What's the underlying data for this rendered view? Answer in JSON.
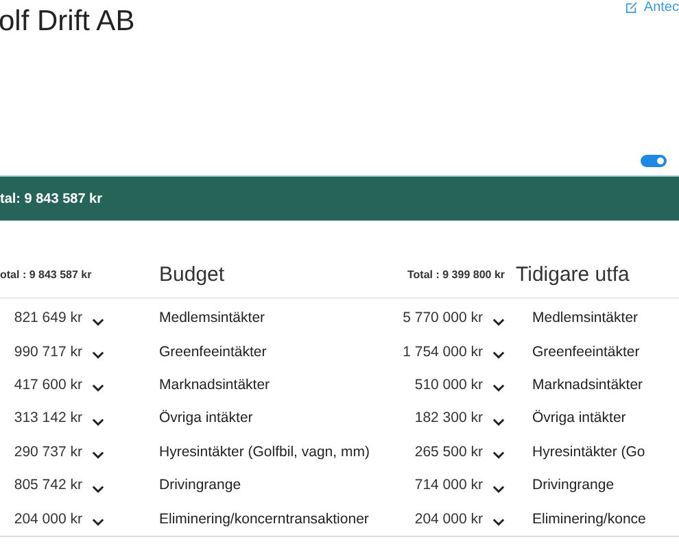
{
  "title": "olf Drift AB",
  "notes_link": "Antec",
  "toggle": {
    "on": true
  },
  "summary_bar": {
    "total": "tal: 9 843 587 kr"
  },
  "table": {
    "header": {
      "left_total": "otal : 9 843 587 kr",
      "budget_heading": "Budget",
      "budget_total": "Total : 9 399 800 kr",
      "previous_heading": "Tidigare utfa"
    },
    "rows": [
      {
        "amount": "821 649 kr",
        "budget_name": "Medlemsintäkter",
        "budget_amount": "5 770 000 kr",
        "previous_name": "Medlemsintäkter"
      },
      {
        "amount": "990 717 kr",
        "budget_name": "Greenfeeintäkter",
        "budget_amount": "1 754 000 kr",
        "previous_name": "Greenfeeintäkter"
      },
      {
        "amount": "417 600 kr",
        "budget_name": "Marknadsintäkter",
        "budget_amount": "510 000 kr",
        "previous_name": "Marknadsintäkter"
      },
      {
        "amount": "313 142 kr",
        "budget_name": "Övriga intäkter",
        "budget_amount": "182 300 kr",
        "previous_name": "Övriga intäkter"
      },
      {
        "amount": "290 737 kr",
        "budget_name": "Hyresintäkter (Golfbil, vagn, mm)",
        "budget_amount": "265 500 kr",
        "previous_name": "Hyresintäkter (Go"
      },
      {
        "amount": "805 742 kr",
        "budget_name": "Drivingrange",
        "budget_amount": "714 000 kr",
        "previous_name": "Drivingrange"
      },
      {
        "amount": "204 000 kr",
        "budget_name": "Eliminering/koncerntransaktioner",
        "budget_amount": "204 000 kr",
        "previous_name": "Eliminering/konce"
      }
    ]
  }
}
